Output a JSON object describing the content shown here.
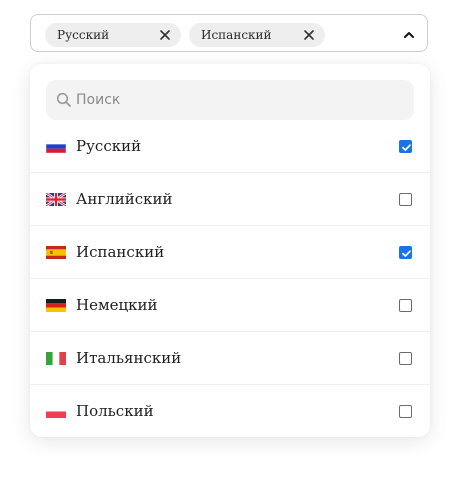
{
  "select": {
    "chips": [
      {
        "label": "Русский"
      },
      {
        "label": "Испанский"
      }
    ],
    "expanded_icon": "chevron-up-icon"
  },
  "dropdown": {
    "search": {
      "placeholder": "Поиск",
      "value": ""
    },
    "options": [
      {
        "label": "Русский",
        "flag": "russia-flag-icon",
        "checked": true
      },
      {
        "label": "Английский",
        "flag": "uk-flag-icon",
        "checked": false
      },
      {
        "label": "Испанский",
        "flag": "spain-flag-icon",
        "checked": true
      },
      {
        "label": "Немецкий",
        "flag": "germany-flag-icon",
        "checked": false
      },
      {
        "label": "Итальянский",
        "flag": "italy-flag-icon",
        "checked": false
      },
      {
        "label": "Польский",
        "flag": "poland-flag-icon",
        "checked": false
      }
    ]
  },
  "colors": {
    "accent": "#1a73e8",
    "chip_bg": "#eeeeee",
    "search_bg": "#f3f3f3",
    "border": "#cfcfcf"
  }
}
